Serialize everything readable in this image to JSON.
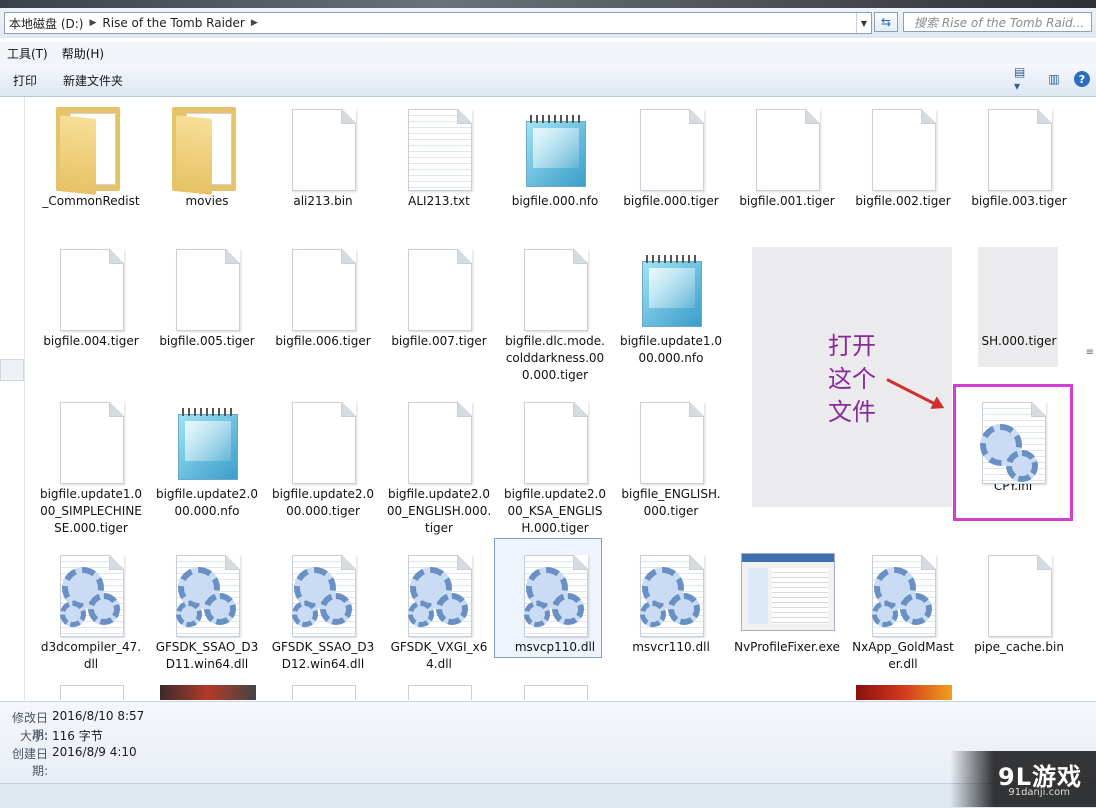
{
  "address_bar": {
    "crumbs": [
      "本地磁盘 (D:)",
      "Rise of the Tomb Raider"
    ],
    "search_placeholder": "搜索 Rise of the Tomb Raid..."
  },
  "menu": {
    "items": [
      "工具(T)",
      "帮助(H)"
    ]
  },
  "commands": {
    "print": "打印",
    "new_folder": "新建文件夹"
  },
  "files": [
    {
      "name": "_CommonRedist",
      "type": "folder"
    },
    {
      "name": "movies",
      "type": "folder"
    },
    {
      "name": "ali213.bin",
      "type": "file"
    },
    {
      "name": "ALI213.txt",
      "type": "text"
    },
    {
      "name": "bigfile.000.nfo",
      "type": "notepad"
    },
    {
      "name": "bigfile.000.tiger",
      "type": "file"
    },
    {
      "name": "bigfile.001.tiger",
      "type": "file"
    },
    {
      "name": "bigfile.002.tiger",
      "type": "file"
    },
    {
      "name": "bigfile.003.tiger",
      "type": "file"
    },
    {
      "name": "bigfile.004.tiger",
      "type": "file"
    },
    {
      "name": "bigfile.005.tiger",
      "type": "file"
    },
    {
      "name": "bigfile.006.tiger",
      "type": "file"
    },
    {
      "name": "bigfile.007.tiger",
      "type": "file"
    },
    {
      "name": "bigfile.dlc.mode.colddarkness.000.000.tiger",
      "type": "file"
    },
    {
      "name": "bigfile.update1.000.000.nfo",
      "type": "notepad"
    },
    {
      "name": "SH.000.tiger",
      "type": "file"
    },
    {
      "name": "bigfile.update1.000_SIMPLECHINESE.000.tiger",
      "type": "file"
    },
    {
      "name": "bigfile.update2.000.000.nfo",
      "type": "notepad"
    },
    {
      "name": "bigfile.update2.000.000.tiger",
      "type": "file"
    },
    {
      "name": "bigfile.update2.000_ENGLISH.000.tiger",
      "type": "file"
    },
    {
      "name": "bigfile.update2.000_KSA_ENGLISH.000.tiger",
      "type": "file"
    },
    {
      "name": "bigfile_ENGLISH.000.tiger",
      "type": "file"
    },
    {
      "name": "CPY.ini",
      "type": "config"
    },
    {
      "name": "d3dcompiler_47.dll",
      "type": "dll"
    },
    {
      "name": "GFSDK_SSAO_D3D11.win64.dll",
      "type": "dll"
    },
    {
      "name": "GFSDK_SSAO_D3D12.win64.dll",
      "type": "dll"
    },
    {
      "name": "GFSDK_VXGI_x64.dll",
      "type": "dll"
    },
    {
      "name": "msvcp110.dll",
      "type": "dll"
    },
    {
      "name": "msvcr110.dll",
      "type": "dll"
    },
    {
      "name": "NvProfileFixer.exe",
      "type": "exe"
    },
    {
      "name": "NxApp_GoldMaster.dll",
      "type": "dll"
    },
    {
      "name": "pipe_cache.bin",
      "type": "file"
    }
  ],
  "annotation": {
    "lines": [
      "打开",
      "这个",
      "文件"
    ],
    "color": "#8a2a9a",
    "box_color": "#cf3fd1"
  },
  "details": {
    "modified_label": "修改日期:",
    "modified_value": "2016/8/10 8:57",
    "size_label": "大小:",
    "size_value": "116 字节",
    "created_label": "创建日期:",
    "created_value": "2016/8/9 4:10"
  },
  "watermark": {
    "logo": "9L游戏",
    "url": "91danji.com"
  }
}
